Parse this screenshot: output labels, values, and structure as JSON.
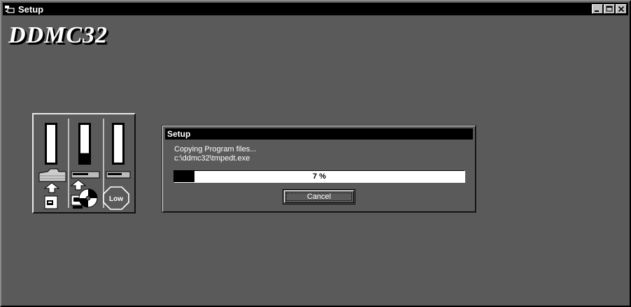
{
  "window": {
    "title": "Setup",
    "controls": [
      "minimize-icon",
      "maximize-icon",
      "close-icon"
    ]
  },
  "brand": {
    "text": "DDMC32"
  },
  "gauges": {
    "levels": [
      0.0,
      0.25,
      0.0
    ],
    "icons": [
      "folder-icon",
      "disk-drive-icon",
      "hard-drive-icon",
      "arrow-up-icon",
      "arrow-up-icon",
      "file-icon",
      "cd-disk-icon",
      "low-badge-icon"
    ],
    "low_label": "Low"
  },
  "dialog": {
    "title": "Setup",
    "status_line": "Copying Program files...",
    "file_path": "c:\\ddmc32\\tmpedt.exe",
    "progress_value": 7,
    "progress_label": "7 %",
    "cancel_label": "Cancel"
  },
  "colors": {
    "background": "#5a5a5a",
    "titlebar": "#000000",
    "text_light": "#ffffff",
    "progress_fill": "#000000"
  }
}
